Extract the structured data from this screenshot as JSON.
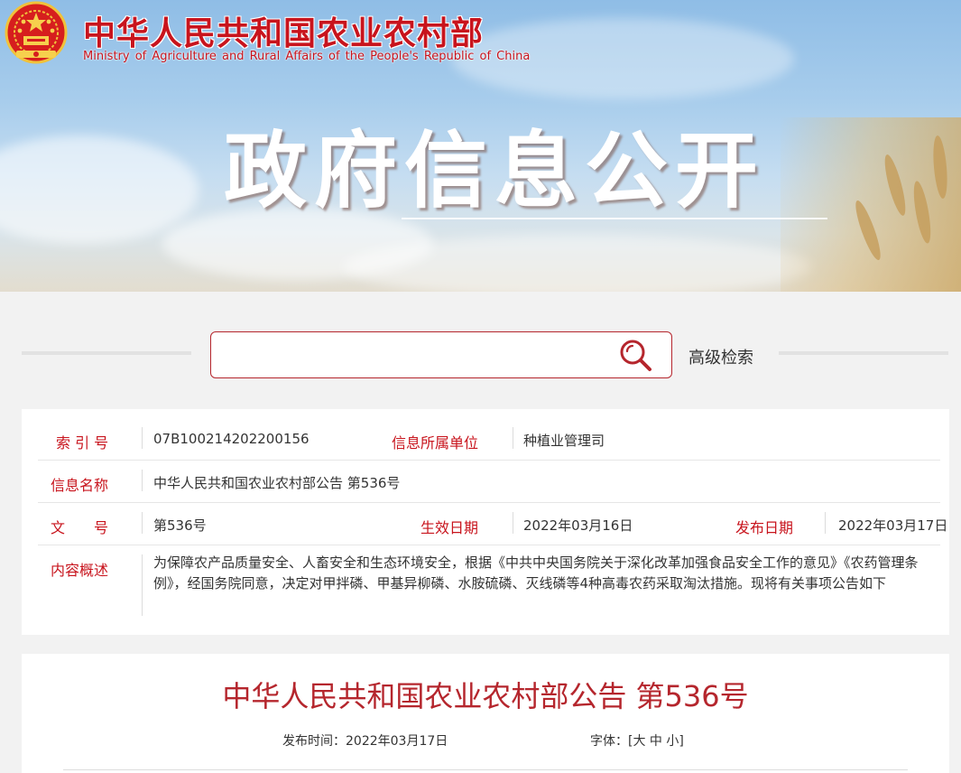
{
  "header": {
    "ministry_cn": "中华人民共和国农业农村部",
    "ministry_en": "Ministry of Agriculture and Rural Affairs of the People's Republic of China",
    "section_title": "政府信息公开",
    "brand_color": "#c8141d"
  },
  "search": {
    "query": "",
    "icon": "search-icon",
    "advanced_label": "高级检索"
  },
  "info": {
    "index_label": "索 引 号",
    "index_value": "07B100214202200156",
    "dept_label": "信息所属单位",
    "dept_value": "种植业管理司",
    "name_label": "信息名称",
    "name_value": "中华人民共和国农业农村部公告 第536号",
    "doc_label": "文　　号",
    "doc_value": "第536号",
    "effective_label": "生效日期",
    "effective_value": "2022年03月16日",
    "publish_label": "发布日期",
    "publish_value": "2022年03月17日",
    "summary_label": "内容概述",
    "summary_value": "为保障农产品质量安全、人畜安全和生态环境安全，根据《中共中央国务院关于深化改革加强食品安全工作的意见》《农药管理条例》，经国务院同意，决定对甲拌磷、甲基异柳磷、水胺硫磷、灭线磷等4种高毒农药采取淘汰措施。现将有关事项公告如下"
  },
  "article": {
    "title": "中华人民共和国农业农村部公告 第536号",
    "time_label": "发布时间：",
    "time_value": "2022年03月17日",
    "font_label": "字体：",
    "font_open": "[",
    "font_large": "大",
    "font_medium": "中",
    "font_small": "小",
    "font_close": "]"
  }
}
